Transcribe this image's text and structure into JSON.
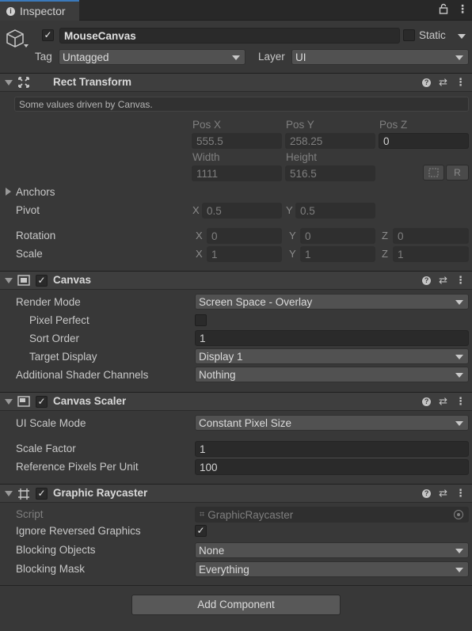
{
  "tab": {
    "title": "Inspector"
  },
  "gameobject": {
    "name": "MouseCanvas",
    "static_label": "Static",
    "tag_label": "Tag",
    "tag_value": "Untagged",
    "layer_label": "Layer",
    "layer_value": "UI"
  },
  "rect_transform": {
    "title": "Rect Transform",
    "notice": "Some values driven by Canvas.",
    "pos_x_label": "Pos X",
    "pos_y_label": "Pos Y",
    "pos_z_label": "Pos Z",
    "pos_x": "555.5",
    "pos_y": "258.25",
    "pos_z": "0",
    "width_label": "Width",
    "height_label": "Height",
    "width": "1111",
    "height": "516.5",
    "r_label": "R",
    "anchors_label": "Anchors",
    "pivot_label": "Pivot",
    "pivot_x": "0.5",
    "pivot_y": "0.5",
    "rotation_label": "Rotation",
    "rot_x": "0",
    "rot_y": "0",
    "rot_z": "0",
    "scale_label": "Scale",
    "scale_x": "1",
    "scale_y": "1",
    "scale_z": "1",
    "x": "X",
    "y": "Y",
    "z": "Z"
  },
  "canvas": {
    "title": "Canvas",
    "render_mode_label": "Render Mode",
    "render_mode": "Screen Space - Overlay",
    "pixel_perfect_label": "Pixel Perfect",
    "sort_order_label": "Sort Order",
    "sort_order": "1",
    "target_display_label": "Target Display",
    "target_display": "Display 1",
    "shader_channels_label": "Additional Shader Channels",
    "shader_channels": "Nothing"
  },
  "canvas_scaler": {
    "title": "Canvas Scaler",
    "ui_scale_mode_label": "UI Scale Mode",
    "ui_scale_mode": "Constant Pixel Size",
    "scale_factor_label": "Scale Factor",
    "scale_factor": "1",
    "ref_ppu_label": "Reference Pixels Per Unit",
    "ref_ppu": "100"
  },
  "graphic_raycaster": {
    "title": "Graphic Raycaster",
    "script_label": "Script",
    "script": "GraphicRaycaster",
    "ignore_reversed_label": "Ignore Reversed Graphics",
    "blocking_objects_label": "Blocking Objects",
    "blocking_objects": "None",
    "blocking_mask_label": "Blocking Mask",
    "blocking_mask": "Everything"
  },
  "add_component": "Add Component",
  "icons": {
    "lock": "lock-icon",
    "menu": "kebab-menu-icon",
    "help": "help-icon",
    "preset": "preset-icon"
  }
}
